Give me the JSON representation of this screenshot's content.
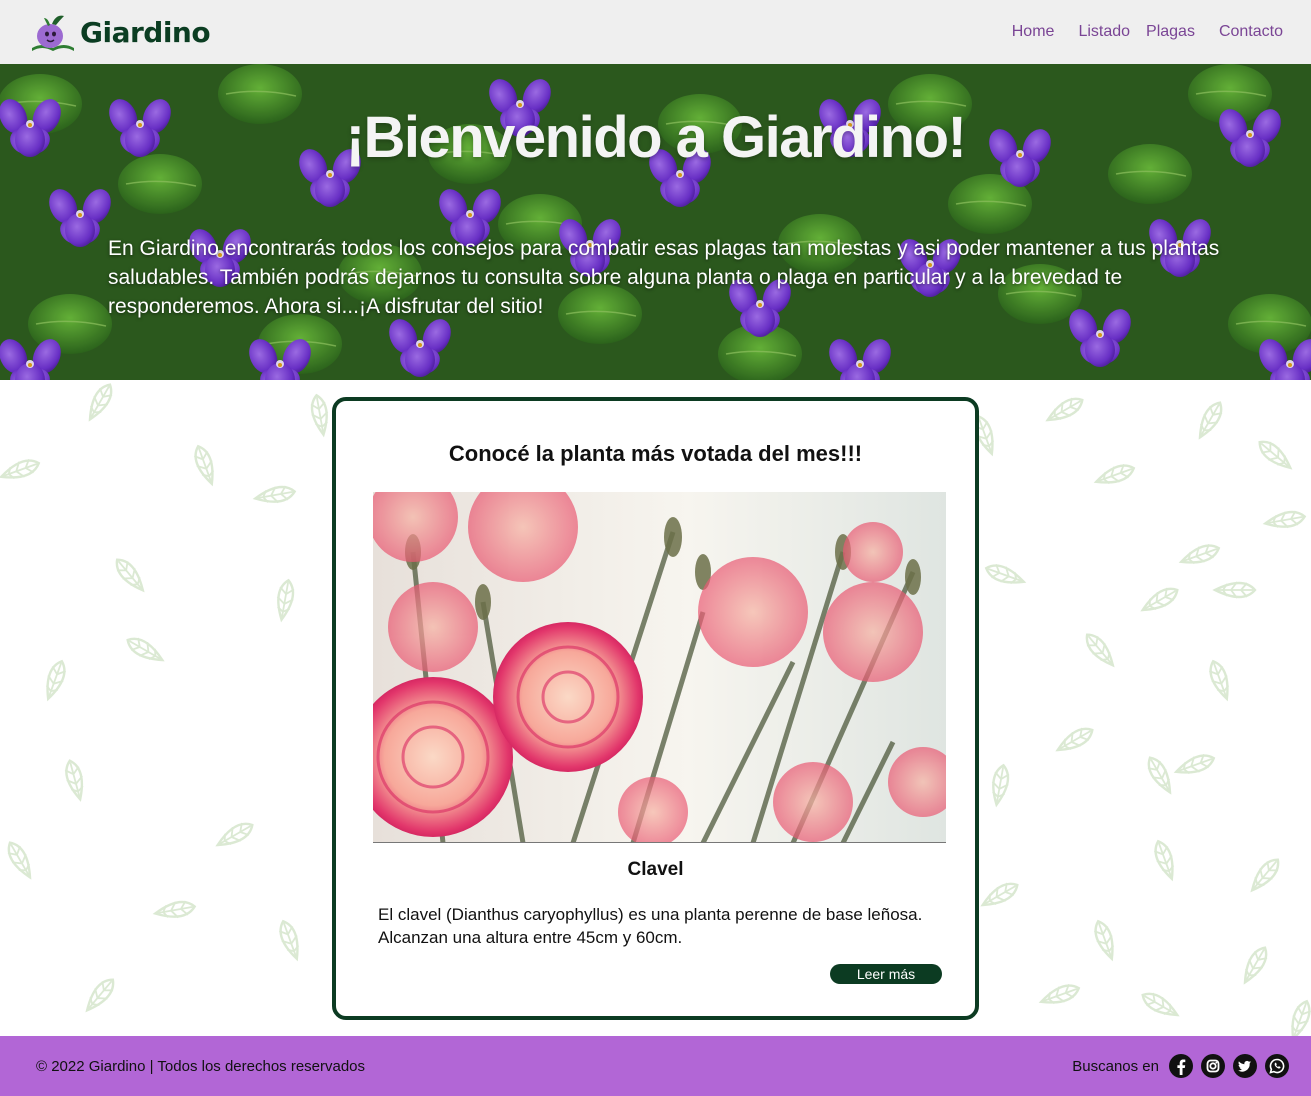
{
  "header": {
    "brand": "Giardino",
    "nav": [
      "Home",
      "Listado",
      "Plagas",
      "Contacto"
    ]
  },
  "hero": {
    "title": "¡Bienvenido a Giardino!",
    "text": "En Giardino encontrarás todos los consejos para combatir esas plagas tan molestas y asi poder mantener a tus plantas saludables. También podrás dejarnos tu consulta sobre alguna planta o plaga en particular y a la brevedad te responderemos. Ahora si...¡A disfrutar del sitio!"
  },
  "card": {
    "title": "Conocé la planta más votada del mes!!!",
    "plant_name": "Clavel",
    "description": "El clavel (Dianthus caryophyllus) es una planta perenne de base leñosa. Alcanzan una altura entre 45cm y 60cm.",
    "button": "Leer más"
  },
  "footer": {
    "copyright": "© 2022 Giardino | Todos los derechos reservados",
    "social_label": "Buscanos en",
    "social_icons": [
      "facebook-icon",
      "instagram-icon",
      "twitter-icon",
      "whatsapp-icon"
    ]
  },
  "colors": {
    "brand_dark_green": "#0c3b22",
    "nav_purple": "#7a4595",
    "footer_purple": "#b266d6",
    "navbar_bg": "#efefef"
  }
}
